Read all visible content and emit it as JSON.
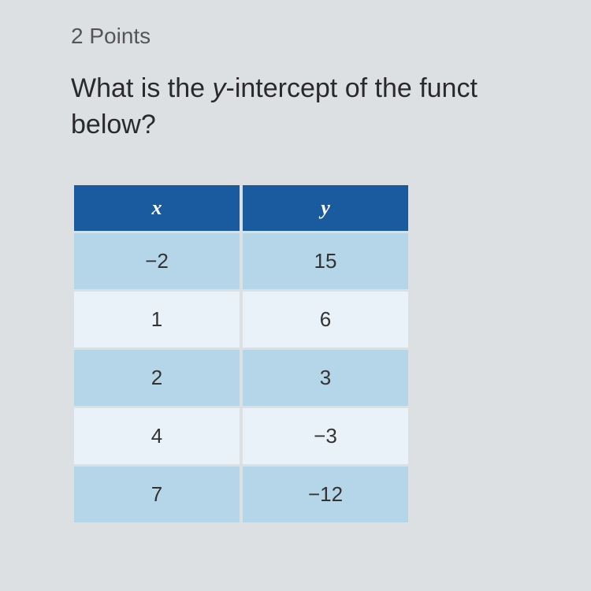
{
  "points_label": "2 Points",
  "question_prefix": "What is the ",
  "question_italic": "y",
  "question_middle": "-intercept of the funct",
  "question_line2": "below?",
  "chart_data": {
    "type": "table",
    "headers": {
      "x": "x",
      "y": "y"
    },
    "rows": [
      {
        "x": "−2",
        "y": "15"
      },
      {
        "x": "1",
        "y": "6"
      },
      {
        "x": "2",
        "y": "3"
      },
      {
        "x": "4",
        "y": "−3"
      },
      {
        "x": "7",
        "y": "−12"
      }
    ]
  }
}
